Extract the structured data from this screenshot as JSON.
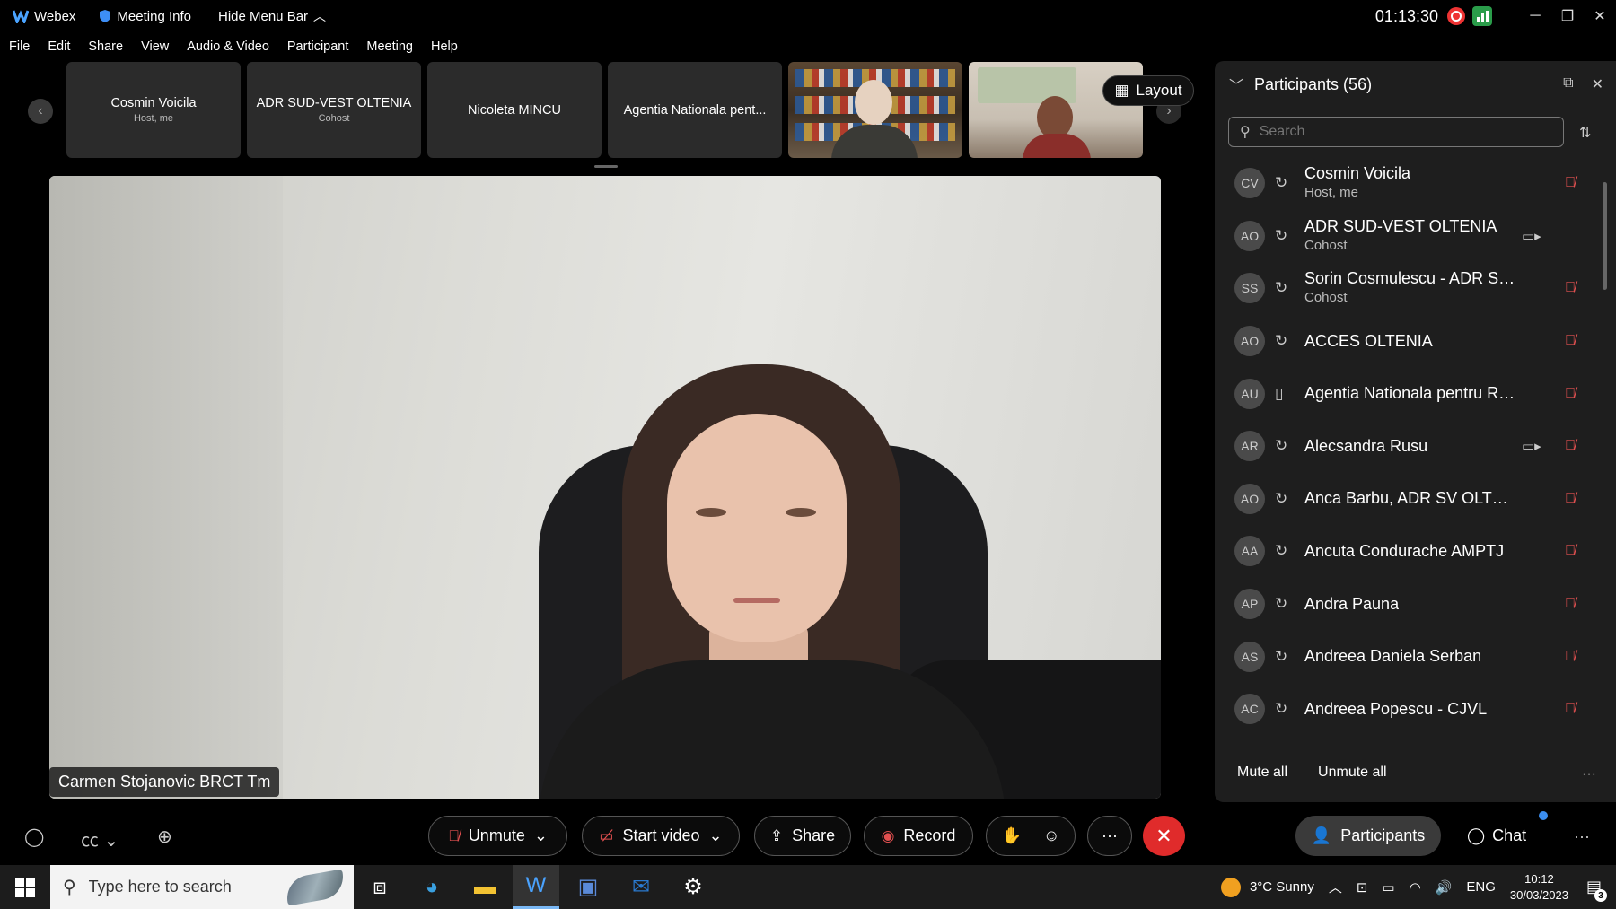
{
  "titlebar": {
    "app_name": "Webex",
    "meeting_info": "Meeting Info",
    "hide_menu": "Hide Menu Bar",
    "clock": "01:13:30"
  },
  "menu": [
    "File",
    "Edit",
    "Share",
    "View",
    "Audio & Video",
    "Participant",
    "Meeting",
    "Help"
  ],
  "thumbnails": [
    {
      "name": "Cosmin Voicila",
      "role": "Host, me"
    },
    {
      "name": "ADR SUD-VEST OLTENIA",
      "role": "Cohost"
    },
    {
      "name": "Nicoleta MINCU",
      "role": ""
    },
    {
      "name": "Agentia Nationala pent...",
      "role": ""
    }
  ],
  "layout_label": "Layout",
  "main_video": {
    "speaker_name": "Carmen Stojanovic BRCT Tm"
  },
  "panel": {
    "title": "Participants (56)",
    "search_placeholder": "Search",
    "mute_all": "Mute all",
    "unmute_all": "Unmute all",
    "participants": [
      {
        "initials": "CV",
        "name": "Cosmin Voicila",
        "role": "Host, me",
        "device": "sync-icon",
        "camera": false,
        "muted": true
      },
      {
        "initials": "AO",
        "name": "ADR SUD-VEST OLTENIA",
        "role": "Cohost",
        "device": "sync-icon",
        "camera": true,
        "muted": false
      },
      {
        "initials": "SS",
        "name": "Sorin Cosmulescu - ADR SVO",
        "role": "Cohost",
        "device": "sync-icon",
        "camera": false,
        "muted": true
      },
      {
        "initials": "AO",
        "name": "ACCES OLTENIA",
        "role": "",
        "device": "sync-icon",
        "camera": false,
        "muted": true
      },
      {
        "initials": "AU",
        "name": "Agentia Nationala pentru Ro...",
        "role": "",
        "device": "phone-icon",
        "camera": false,
        "muted": true
      },
      {
        "initials": "AR",
        "name": "Alecsandra Rusu",
        "role": "",
        "device": "sync-icon",
        "camera": true,
        "muted": true
      },
      {
        "initials": "AO",
        "name": "Anca Barbu, ADR SV OLTENIA",
        "role": "",
        "device": "sync-icon",
        "camera": false,
        "muted": true
      },
      {
        "initials": "AA",
        "name": "Ancuta Condurache AMPTJ",
        "role": "",
        "device": "sync-icon",
        "camera": false,
        "muted": true
      },
      {
        "initials": "AP",
        "name": "Andra Pauna",
        "role": "",
        "device": "sync-icon",
        "camera": false,
        "muted": true
      },
      {
        "initials": "AS",
        "name": "Andreea Daniela Serban",
        "role": "",
        "device": "sync-icon",
        "camera": false,
        "muted": true
      },
      {
        "initials": "AC",
        "name": "Andreea Popescu - CJVL",
        "role": "",
        "device": "sync-icon",
        "camera": false,
        "muted": true
      }
    ]
  },
  "controls": {
    "unmute": "Unmute",
    "start_video": "Start video",
    "share": "Share",
    "record": "Record",
    "participants": "Participants",
    "chat": "Chat"
  },
  "taskbar": {
    "search_placeholder": "Type here to search",
    "weather": "3°C  Sunny",
    "language": "ENG",
    "time": "10:12",
    "date": "30/03/2023",
    "notifications": "3"
  },
  "colors": {
    "leave_red": "#e02b2b",
    "mute_red": "#e25050",
    "panel_bg": "#1e1e1e",
    "chat_badge": "#3b8ef0"
  }
}
